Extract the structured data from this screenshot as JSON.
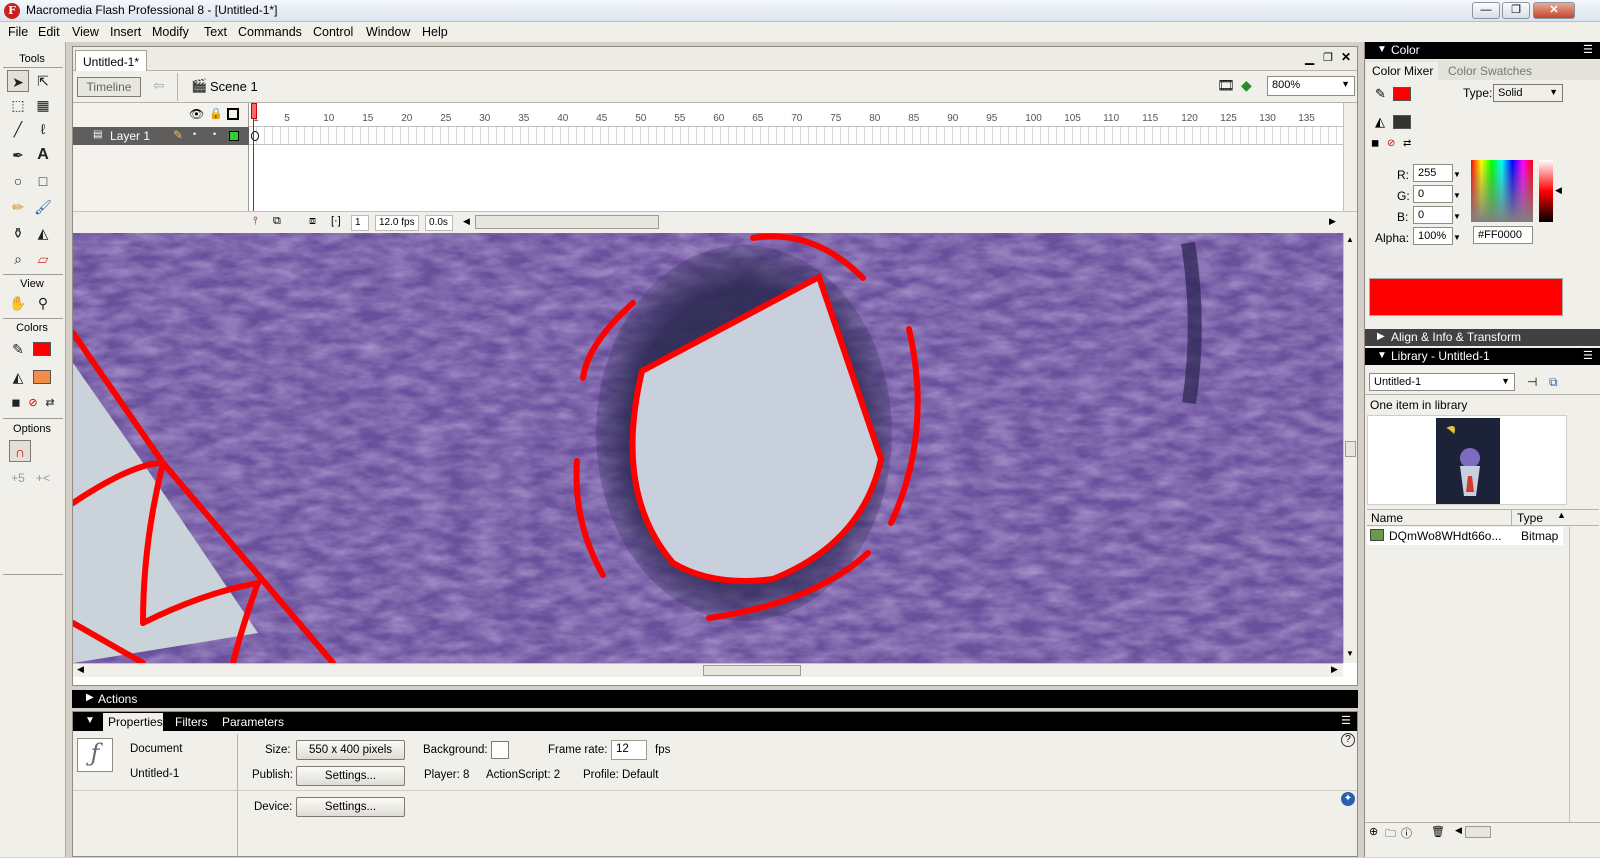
{
  "window": {
    "title": "Macromedia Flash Professional 8 - [Untitled-1*]",
    "logo_letter": "F",
    "controls": {
      "minimize": "—",
      "restore": "❐",
      "close": "✕"
    }
  },
  "menu": [
    "File",
    "Edit",
    "View",
    "Insert",
    "Modify",
    "Text",
    "Commands",
    "Control",
    "Window",
    "Help"
  ],
  "tools": {
    "title": "Tools",
    "view_label": "View",
    "colors_label": "Colors",
    "options_label": "Options",
    "stroke_color": "#000000",
    "fill_color": "#ff0000",
    "fill_color_2": "#f28c48"
  },
  "document": {
    "tab": "Untitled-1*",
    "timeline_button": "Timeline",
    "scene": "Scene 1",
    "zoom": "800%"
  },
  "timeline": {
    "layer_name": "Layer 1",
    "ruler": [
      "1",
      "5",
      "10",
      "15",
      "20",
      "25",
      "30",
      "35",
      "40",
      "45",
      "50",
      "55",
      "60",
      "65",
      "70",
      "75",
      "80",
      "85",
      "90",
      "95",
      "100",
      "105",
      "110",
      "115",
      "120",
      "125",
      "130",
      "135"
    ],
    "current_frame": "1",
    "fps": "12.0 fps",
    "elapsed": "0.0s"
  },
  "panels": {
    "actions": "Actions",
    "properties_tabs": [
      "Properties",
      "Filters",
      "Parameters"
    ],
    "properties": {
      "doc_type": "Document",
      "doc_name": "Untitled-1",
      "size_label": "Size:",
      "size_value": "550 x 400 pixels",
      "background_label": "Background:",
      "frame_rate_label": "Frame rate:",
      "frame_rate": "12",
      "fps_unit": "fps",
      "publish_label": "Publish:",
      "publish_settings": "Settings...",
      "player": "Player: 8",
      "actionscript": "ActionScript: 2",
      "profile": "Profile: Default",
      "device_label": "Device:",
      "device_settings": "Settings..."
    }
  },
  "color_panel": {
    "title": "Color",
    "tabs": [
      "Color Mixer",
      "Color Swatches"
    ],
    "type_label": "Type:",
    "type_value": "Solid",
    "r_label": "R:",
    "r": "255",
    "g_label": "G:",
    "g": "0",
    "b_label": "B:",
    "b": "0",
    "alpha_label": "Alpha:",
    "alpha": "100%",
    "hex": "#FF0000",
    "swatch": "#ff0000"
  },
  "align_panel": {
    "title": "Align & Info & Transform"
  },
  "library_panel": {
    "title": "Library - Untitled-1",
    "dropdown": "Untitled-1",
    "count": "One item in library",
    "columns": [
      "Name",
      "Type"
    ],
    "items": [
      {
        "name": "DQmWo8WHdt66o...",
        "type": "Bitmap"
      }
    ]
  }
}
